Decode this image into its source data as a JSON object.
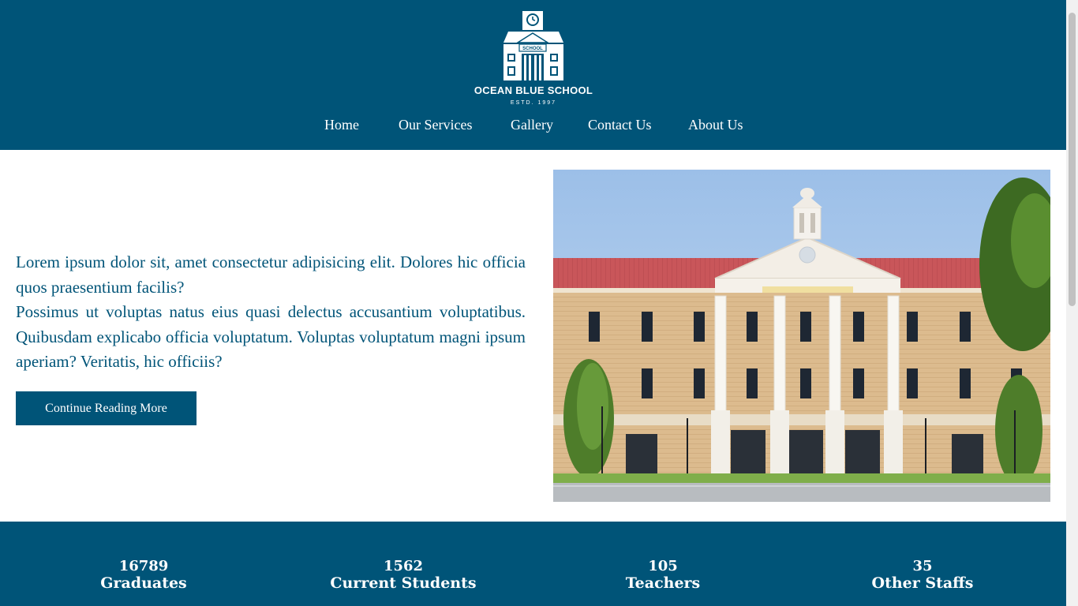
{
  "brand": {
    "name": "OCEAN BLUE SCHOOL",
    "established": "ESTD. 1997",
    "building_sign": "SCHOOL"
  },
  "nav": {
    "items": [
      {
        "label": "Home"
      },
      {
        "label": "Our Services"
      },
      {
        "label": "Gallery"
      },
      {
        "label": "Contact Us"
      },
      {
        "label": "About Us"
      }
    ]
  },
  "hero": {
    "paragraph1": "Lorem ipsum dolor sit, amet consectetur adipisicing elit. Dolores hic officia quos praesentium facilis?",
    "paragraph2": "Possimus ut voluptas natus eius quasi delectus accusantium voluptatibus. Quibusdam explicabo officia voluptatum. Voluptas voluptatum magni ipsum aperiam? Veritatis, hic officiis?",
    "button_label": "Continue Reading More",
    "image_alt": "Ocean Blue School building exterior"
  },
  "stats": [
    {
      "value": "16789",
      "label": "Graduates"
    },
    {
      "value": "1562",
      "label": "Current Students"
    },
    {
      "value": "105",
      "label": "Teachers"
    },
    {
      "value": "35",
      "label": "Other Staffs"
    }
  ],
  "colors": {
    "primary": "#005478",
    "text": "#005478",
    "background": "#ffffff"
  }
}
